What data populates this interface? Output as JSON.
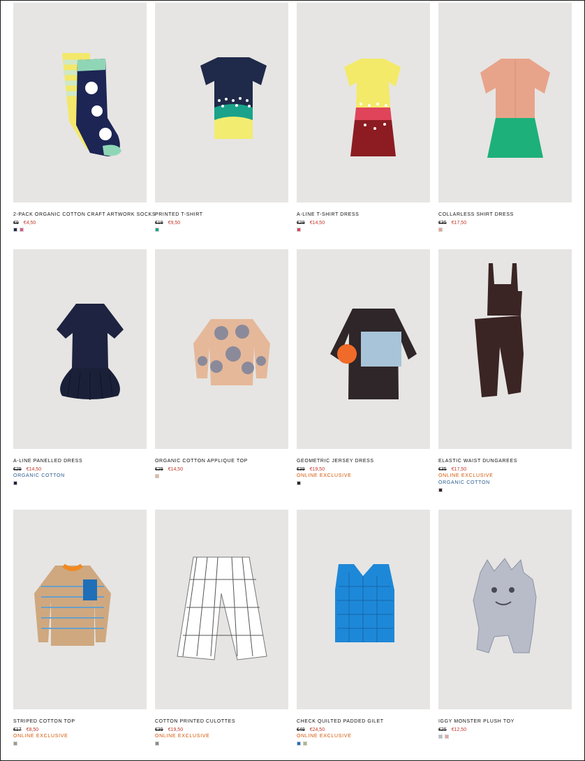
{
  "products": [
    {
      "name": "2-PACK ORGANIC COTTON CRAFT ARTWORK SOCKS",
      "old_price": "€9",
      "price": "€4,50",
      "tags": [],
      "swatches": [
        "#1f2a4a",
        "#d65a8a"
      ]
    },
    {
      "name": "PRINTED T-SHIRT",
      "old_price": "€19",
      "price": "€9,50",
      "tags": [],
      "swatches": [
        "#1aa38a"
      ]
    },
    {
      "name": "A-LINE T-SHIRT DRESS",
      "old_price": "€29",
      "price": "€14,50",
      "tags": [],
      "swatches": [
        "#d8455a"
      ]
    },
    {
      "name": "COLLARLESS SHIRT DRESS",
      "old_price": "€35",
      "price": "€17,50",
      "tags": [],
      "swatches": [
        "#e8a48a"
      ]
    },
    {
      "name": "A-LINE PANELLED DRESS",
      "old_price": "€29",
      "price": "€14,50",
      "tags": [
        "ORGANIC COTTON"
      ],
      "swatches": [
        "#1d2340"
      ]
    },
    {
      "name": "ORGANIC COTTON APPLIQUE TOP",
      "old_price": "€29",
      "price": "€14,50",
      "tags": [],
      "swatches": [
        "#e5b89a"
      ]
    },
    {
      "name": "GEOMETRIC JERSEY DRESS",
      "old_price": "€39",
      "price": "€19,50",
      "tags": [
        "ONLINE EXCLUSIVE"
      ],
      "swatches": [
        "#2e2628"
      ]
    },
    {
      "name": "ELASTIC WAIST DUNGAREES",
      "old_price": "€35",
      "price": "€17,50",
      "tags": [
        "ONLINE EXCLUSIVE",
        "ORGANIC COTTON"
      ],
      "swatches": [
        "#3b2424"
      ]
    },
    {
      "name": "STRIPED COTTON TOP",
      "old_price": "€17",
      "price": "€8,50",
      "tags": [
        "ONLINE EXCLUSIVE"
      ],
      "swatches": [
        "#9a9a8a"
      ]
    },
    {
      "name": "COTTON PRINTED CULOTTES",
      "old_price": "€39",
      "price": "€19,50",
      "tags": [
        "ONLINE EXCLUSIVE"
      ],
      "swatches": [
        "#8a8a8a"
      ]
    },
    {
      "name": "CHECK QUILTED PADDED GILET",
      "old_price": "€49",
      "price": "€24,50",
      "tags": [
        "ONLINE EXCLUSIVE"
      ],
      "swatches": [
        "#1e6fb8",
        "#a9b98a"
      ]
    },
    {
      "name": "IGGY MONSTER PLUSH TOY",
      "old_price": "€25",
      "price": "€12,50",
      "tags": [],
      "swatches": [
        "#b8bcc8",
        "#e0a8a0"
      ]
    }
  ]
}
